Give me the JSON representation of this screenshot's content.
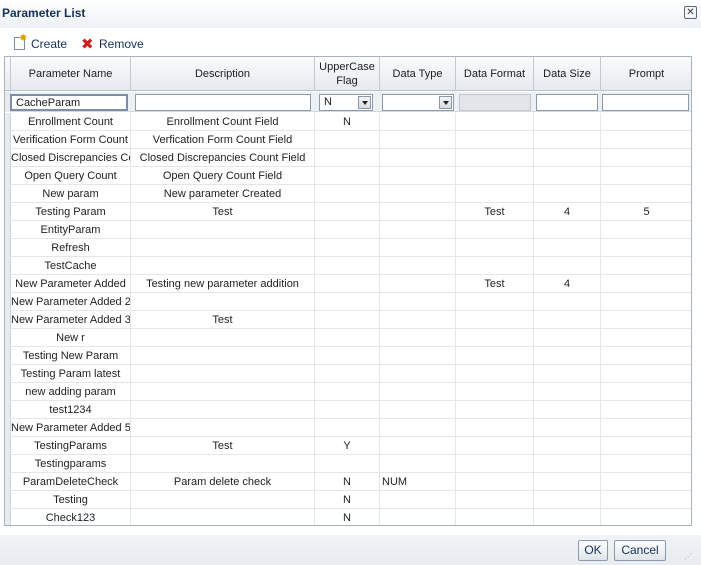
{
  "dialog": {
    "title": "Parameter List"
  },
  "toolbar": {
    "create_label": "Create",
    "remove_label": "Remove"
  },
  "table": {
    "columns": [
      "Parameter Name",
      "Description",
      "UpperCase Flag",
      "Data Type",
      "Data Format",
      "Data Size",
      "Prompt"
    ],
    "edit_row": {
      "parameter_name": "CacheParam",
      "description": "",
      "uppercase_flag": "N",
      "data_type": "",
      "data_format": "",
      "data_size": "",
      "prompt": ""
    },
    "rows": [
      [
        "Enrollment Count",
        "Enrollment Count Field",
        "N",
        "",
        "",
        "",
        ""
      ],
      [
        "Verification Form Count",
        "Verfication Form Count Field",
        "",
        "",
        "",
        "",
        ""
      ],
      [
        "Closed Discrepancies Cou",
        "Closed Discrepancies Count Field",
        "",
        "",
        "",
        "",
        ""
      ],
      [
        "Open Query Count",
        "Open Query Count Field",
        "",
        "",
        "",
        "",
        ""
      ],
      [
        "New param",
        "New parameter Created",
        "",
        "",
        "",
        "",
        ""
      ],
      [
        "Testing Param",
        "Test",
        "",
        "",
        "Test",
        "4",
        "5"
      ],
      [
        "EntityParam",
        "",
        "",
        "",
        "",
        "",
        ""
      ],
      [
        "Refresh",
        "",
        "",
        "",
        "",
        "",
        ""
      ],
      [
        "TestCache",
        "",
        "",
        "",
        "",
        "",
        ""
      ],
      [
        "New Parameter Added",
        "Testing new parameter addition",
        "",
        "",
        "Test",
        "4",
        ""
      ],
      [
        "New Parameter Added 2",
        "",
        "",
        "",
        "",
        "",
        ""
      ],
      [
        "New Parameter Added 3",
        "Test",
        "",
        "",
        "",
        "",
        ""
      ],
      [
        "New r",
        "",
        "",
        "",
        "",
        "",
        ""
      ],
      [
        "Testing New Param",
        "",
        "",
        "",
        "",
        "",
        ""
      ],
      [
        "Testing Param latest",
        "",
        "",
        "",
        "",
        "",
        ""
      ],
      [
        "new adding param",
        "",
        "",
        "",
        "",
        "",
        ""
      ],
      [
        "test1234",
        "",
        "",
        "",
        "",
        "",
        ""
      ],
      [
        "New Parameter Added 5",
        "",
        "",
        "",
        "",
        "",
        ""
      ],
      [
        "TestingParams",
        "Test",
        "Y",
        "",
        "",
        "",
        ""
      ],
      [
        "Testingparams",
        "",
        "",
        "",
        "",
        "",
        ""
      ],
      [
        "ParamDeleteCheck",
        "Param delete check",
        "N",
        "NUM",
        "",
        "",
        ""
      ],
      [
        "Testing",
        "",
        "N",
        "",
        "",
        "",
        ""
      ],
      [
        "Check123",
        "",
        "N",
        "",
        "",
        "",
        ""
      ]
    ]
  },
  "footer": {
    "ok_label": "OK",
    "cancel_label": "Cancel"
  }
}
